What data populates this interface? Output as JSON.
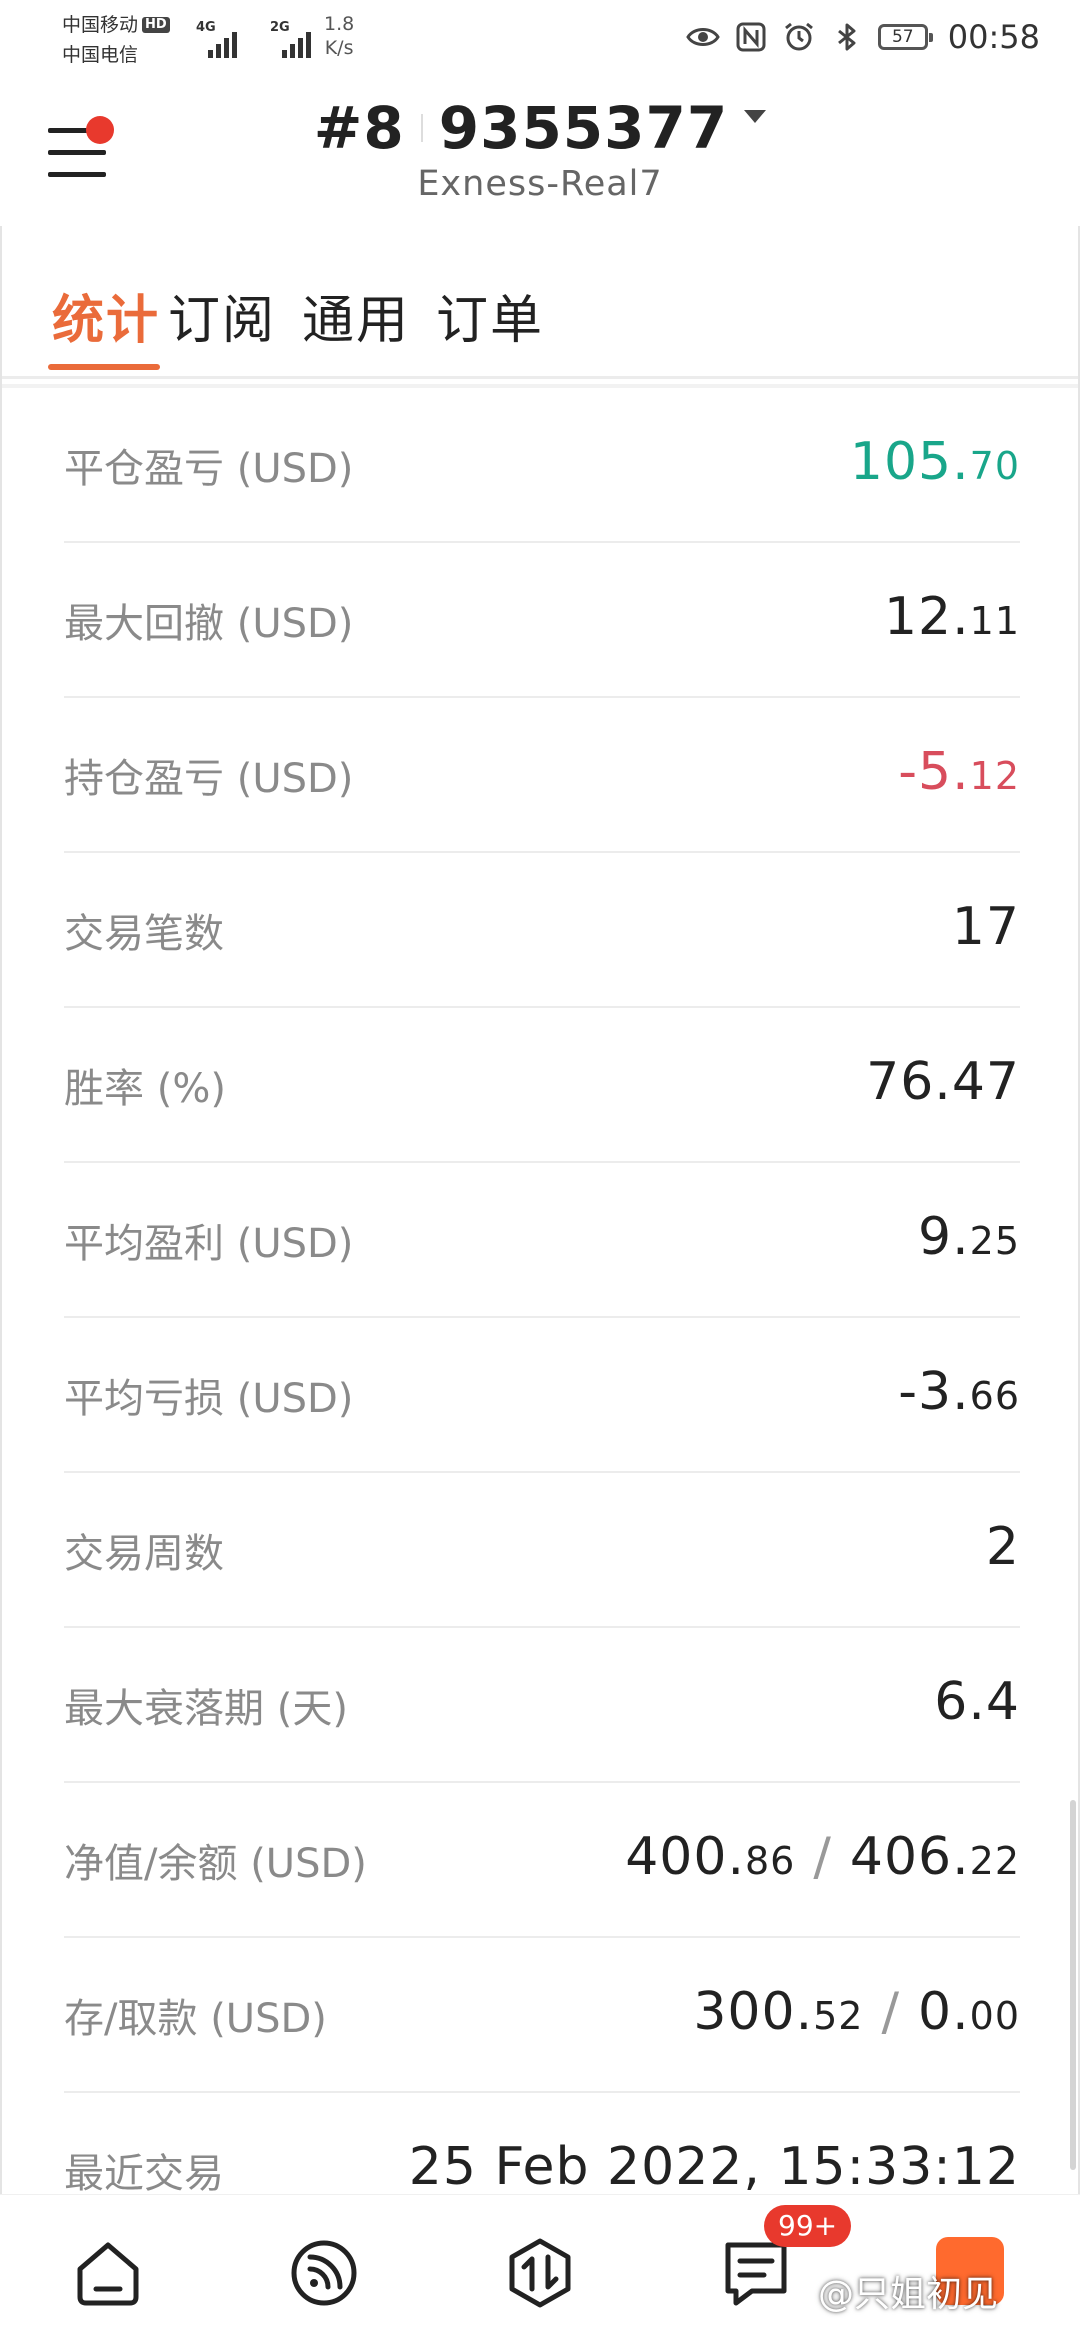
{
  "status_bar": {
    "carrier1": "中国移动",
    "hd_badge": "HD",
    "carrier2": "中国电信",
    "sig1_type": "4G",
    "sig2_type": "2G",
    "speed_value": "1.8",
    "speed_unit": "K/s",
    "battery": "57",
    "time": "00:58",
    "icons": [
      "eye-icon",
      "nfc-icon",
      "alarm-icon",
      "bluetooth-icon",
      "battery-icon"
    ]
  },
  "header": {
    "account_prefix": "#8",
    "account_number": "9355377",
    "server": "Exness-Real7"
  },
  "tabs": [
    {
      "label": "统计",
      "active": true
    },
    {
      "label": "订阅",
      "active": false
    },
    {
      "label": "通用",
      "active": false
    },
    {
      "label": "订单",
      "active": false
    }
  ],
  "stats": [
    {
      "label": "平仓盈亏 (USD)",
      "int": "105.",
      "dec": "70",
      "color": "#19a68a"
    },
    {
      "label": "最大回撤 (USD)",
      "int": "12.",
      "dec": "11"
    },
    {
      "label": "持仓盈亏 (USD)",
      "int": "-5.",
      "dec": "12",
      "color": "#d84d5c"
    },
    {
      "label": "交易笔数",
      "value": "17"
    },
    {
      "label": "胜率 (%)",
      "value": "76.47"
    },
    {
      "label": "平均盈利 (USD)",
      "int": "9.",
      "dec": "25"
    },
    {
      "label": "平均亏损 (USD)",
      "int": "-3.",
      "dec": "66"
    },
    {
      "label": "交易周数",
      "value": "2"
    },
    {
      "label": "最大衰落期 (天)",
      "value": "6.4"
    },
    {
      "label": "净值/余额 (USD)",
      "a_int": "400.",
      "a_dec": "86",
      "slash": "/",
      "b_int": "406.",
      "b_dec": "22"
    },
    {
      "label": "存/取款 (USD)",
      "a_int": "300.",
      "a_dec": "52",
      "slash": "/",
      "b_int": "0.",
      "b_dec": "00"
    },
    {
      "label": "最近交易",
      "value": "25 Feb 2022, 15:33:12"
    }
  ],
  "bottom_nav": {
    "items": [
      "home-icon",
      "signal-icon",
      "trade-icon",
      "messages-icon",
      "app-icon"
    ],
    "badge": "99+",
    "watermark": "@只姐初见"
  },
  "colors": {
    "accent": "#ea6b3a",
    "profit": "#19a68a",
    "loss": "#d84d5c",
    "badge": "#e8392d"
  }
}
